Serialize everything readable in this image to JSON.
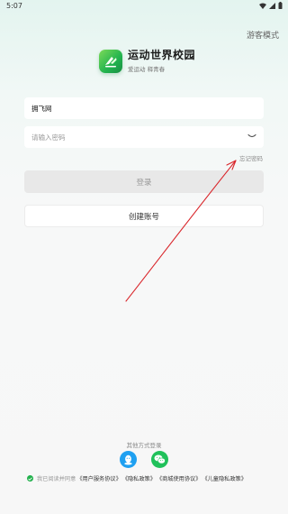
{
  "status_bar": {
    "time": "5:07"
  },
  "header": {
    "visitor_mode": "游客模式"
  },
  "brand": {
    "name": "运动世界校园",
    "slogan": "爱运动 释青春"
  },
  "login_form": {
    "account_value": "拥飞网",
    "password_placeholder": "请输入密码",
    "forgot_password": "忘记密码",
    "login_button": "登录",
    "register_button": "创建账号"
  },
  "other_login": {
    "label": "其他方式登录",
    "methods": [
      {
        "icon": "qq-icon",
        "color": "#1fa0f1"
      },
      {
        "icon": "wechat-icon",
        "color": "#20c15a"
      }
    ]
  },
  "agreement": {
    "prefix": "我已阅读并同意",
    "links": [
      "《用户服务协议》",
      "《隐私政策》",
      "《商城使用协议》",
      "《儿童隐私政策》"
    ]
  },
  "colors": {
    "accent": "#22b14c",
    "annotation_arrow": "#d9262b"
  }
}
